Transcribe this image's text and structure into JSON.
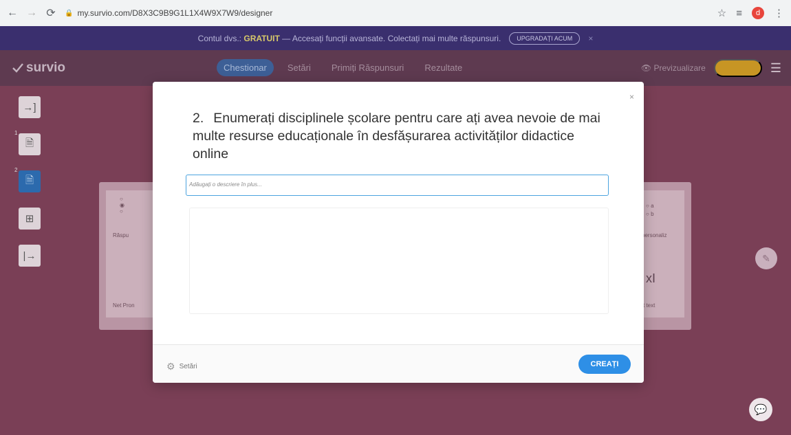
{
  "browser": {
    "url": "my.survio.com/D8X3C9B9G1L1X4W9X7W9/designer",
    "profile_initial": "d"
  },
  "promo": {
    "prefix": "Contul dvs.:",
    "plan": "GRATUIT",
    "text": "— Accesați funcții avansate. Colectați mai multe răspunsuri.",
    "upgrade_label": "UPGRADAȚI ACUM",
    "close": "×"
  },
  "header": {
    "logo": "survio",
    "tabs": [
      "Chestionar",
      "Setări",
      "Primiți Răspunsuri",
      "Rezultate"
    ],
    "preview_label": "Previzualizare",
    "publish_label": ""
  },
  "background": {
    "card_left_label": "Răspu",
    "card_left_bottom": "Net Pron",
    "card_right_label": "personaliz",
    "card_right_options": [
      "a",
      "b"
    ],
    "card_right_bottom": "t text",
    "card_right_icon": "xI"
  },
  "modal": {
    "question_number": "2.",
    "question_text": "Enumerați disciplinele școlare pentru care ați avea nevoie de mai multe resurse educaționale în desfășurarea activităților didactice online",
    "description_placeholder": "Adăugați o descriere în plus...",
    "close": "×",
    "settings_label": "Setări",
    "create_label": "CREAȚI"
  },
  "colors": {
    "background": "#7a3f56",
    "accent": "#2e8fe6",
    "focus_border": "#4aa3df"
  }
}
